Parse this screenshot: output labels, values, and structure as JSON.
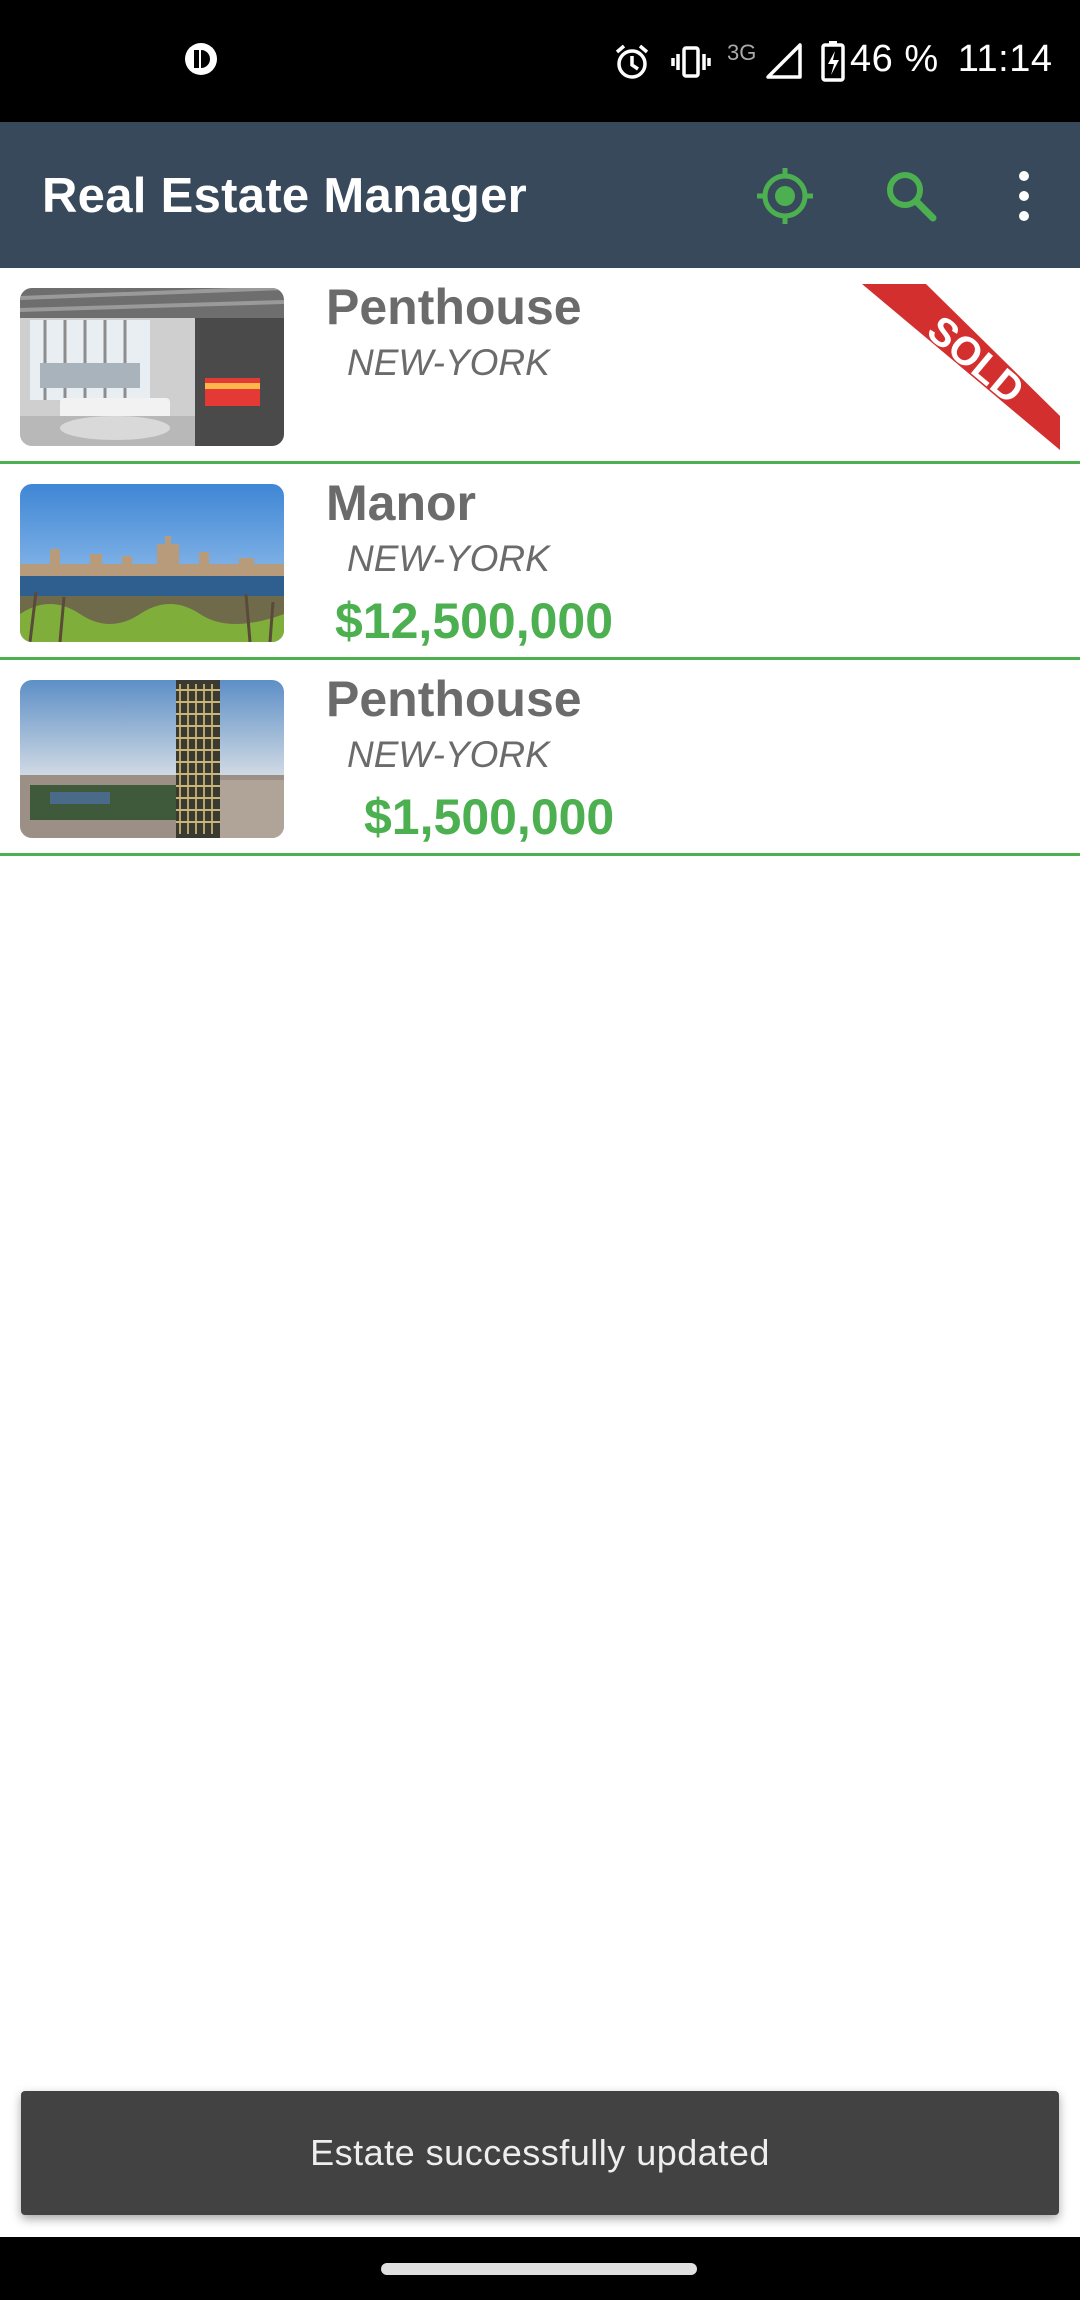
{
  "status_bar": {
    "network": "3G",
    "battery": "46 %",
    "time": "11:14"
  },
  "app_bar": {
    "title": "Real Estate Manager",
    "icons": [
      "location-icon",
      "search-icon",
      "more-vert-icon"
    ]
  },
  "listings": [
    {
      "type": "Penthouse",
      "city": "NEW-YORK",
      "price": "",
      "sold": true,
      "sold_label": "SOLD"
    },
    {
      "type": "Manor",
      "city": "NEW-YORK",
      "price": "$12,500,000",
      "sold": false
    },
    {
      "type": "Penthouse",
      "city": "NEW-YORK",
      "price": "$1,500,000",
      "sold": false
    }
  ],
  "snackbar": {
    "message": "Estate successfully updated"
  },
  "colors": {
    "app_bar": "#37495a",
    "accent": "#4caf50",
    "sold_ribbon": "#d32f2f",
    "snackbar": "#424242"
  }
}
